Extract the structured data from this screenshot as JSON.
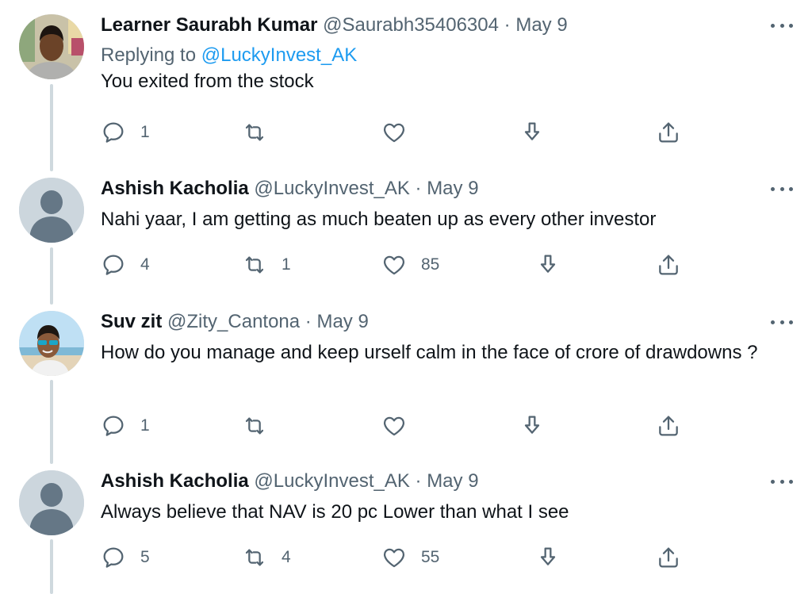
{
  "tweets": [
    {
      "name": "Learner Saurabh Kumar",
      "handle": "@Saurabh35406304",
      "separator": "·",
      "date": "May 9",
      "replying_label": "Replying to",
      "replying_to": "@LuckyInvest_AK",
      "text": "You exited from the stock",
      "counts": {
        "reply": "1",
        "retweet": "",
        "like": ""
      },
      "avatar": "photo-young-man"
    },
    {
      "name": "Ashish Kacholia",
      "handle": "@LuckyInvest_AK",
      "separator": "·",
      "date": "May 9",
      "text": "Nahi yaar, I am getting as much beaten up as every other investor",
      "counts": {
        "reply": "4",
        "retweet": "1",
        "like": "85"
      },
      "avatar": "default-profile"
    },
    {
      "name": "Suv zit",
      "handle": "@Zity_Cantona",
      "separator": "·",
      "date": "May 9",
      "text": "How do you manage and keep urself calm in the face of crore of drawdowns ?",
      "counts": {
        "reply": "1",
        "retweet": "",
        "like": ""
      },
      "avatar": "photo-man-sunglasses-beach"
    },
    {
      "name": "Ashish Kacholia",
      "handle": "@LuckyInvest_AK",
      "separator": "·",
      "date": "May 9",
      "text": "Always believe that NAV is 20 pc Lower than what I see",
      "counts": {
        "reply": "5",
        "retweet": "4",
        "like": "55"
      },
      "avatar": "default-profile"
    }
  ],
  "icons": {
    "reply": "reply-icon",
    "retweet": "retweet-icon",
    "like": "heart-icon",
    "bookmark": "bookmark-download-icon",
    "share": "share-icon",
    "more": "more-options-icon"
  },
  "colors": {
    "text": "#0f1419",
    "secondary": "#536471",
    "link": "#1d9bf0",
    "thread_line": "#cfd9de",
    "default_avatar_bg": "#ccd6dd",
    "default_avatar_fg": "#657786"
  }
}
